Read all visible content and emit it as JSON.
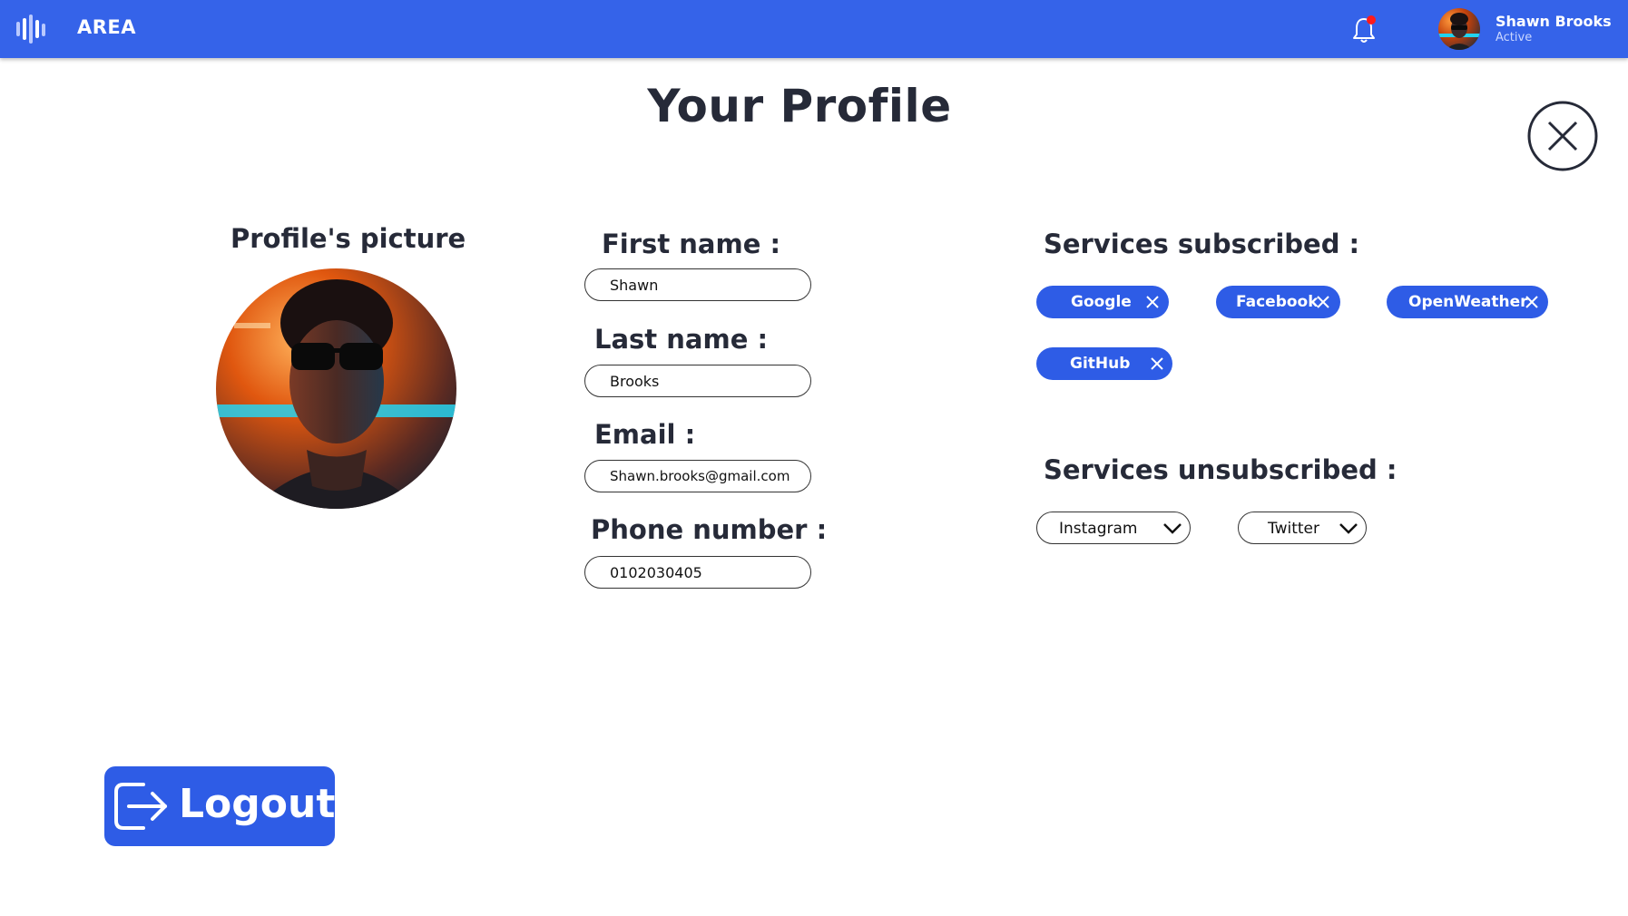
{
  "app": {
    "title": "AREA"
  },
  "user": {
    "name": "Shawn Brooks",
    "status": "Active"
  },
  "notifications": {
    "has_unread": true
  },
  "page": {
    "title": "Your Profile"
  },
  "profile_picture": {
    "label": "Profile's picture"
  },
  "form": {
    "first_name": {
      "label": "First name :",
      "value": "Shawn"
    },
    "last_name": {
      "label": "Last name :",
      "value": "Brooks"
    },
    "email": {
      "label": "Email :",
      "value": "Shawn.brooks@gmail.com"
    },
    "phone": {
      "label": "Phone number :",
      "value": "0102030405"
    }
  },
  "services": {
    "subscribed_label": "Services subscribed :",
    "subscribed": [
      "Google",
      "Facebook",
      "OpenWeather",
      "GitHub"
    ],
    "unsubscribed_label": "Services unsubscribed :",
    "unsubscribed": [
      "Instagram",
      "Twitter"
    ]
  },
  "logout": {
    "label": "Logout"
  },
  "colors": {
    "primary": "#3563e9",
    "chip": "#2e5ce6",
    "text": "#262a38",
    "notification_dot": "#ff1a1a"
  },
  "icons": {
    "logo": "audio-bars-icon",
    "notification": "bell-icon",
    "close": "close-circle-icon",
    "remove": "x-icon",
    "dropdown": "chevron-down-icon",
    "logout": "logout-arrow-icon"
  }
}
